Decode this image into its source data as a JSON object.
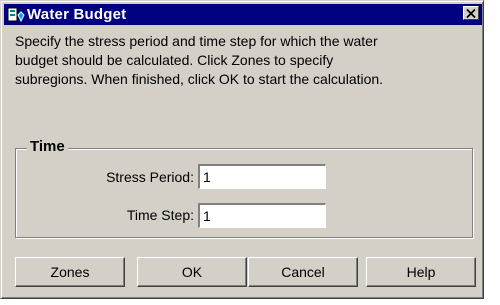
{
  "window": {
    "title": "Water Budget",
    "close_symbol": "✕"
  },
  "instructions": {
    "lines": [
      "Specify the stress period and time step for which the water",
      "budget should be calculated. Click Zones to specify",
      "subregions. When finished, click OK to start the calculation."
    ]
  },
  "time_group": {
    "label": "Time",
    "stress_period": {
      "label": "Stress Period:",
      "value": "1"
    },
    "time_step": {
      "label": "Time Step:",
      "value": "1"
    }
  },
  "buttons": {
    "zones": "Zones",
    "ok": "OK",
    "cancel": "Cancel",
    "help": "Help"
  },
  "colors": {
    "titlebar": "#000080",
    "face": "#d4d0c8"
  },
  "icons": {
    "app": "water-budget-app-icon",
    "close": "close-icon"
  }
}
